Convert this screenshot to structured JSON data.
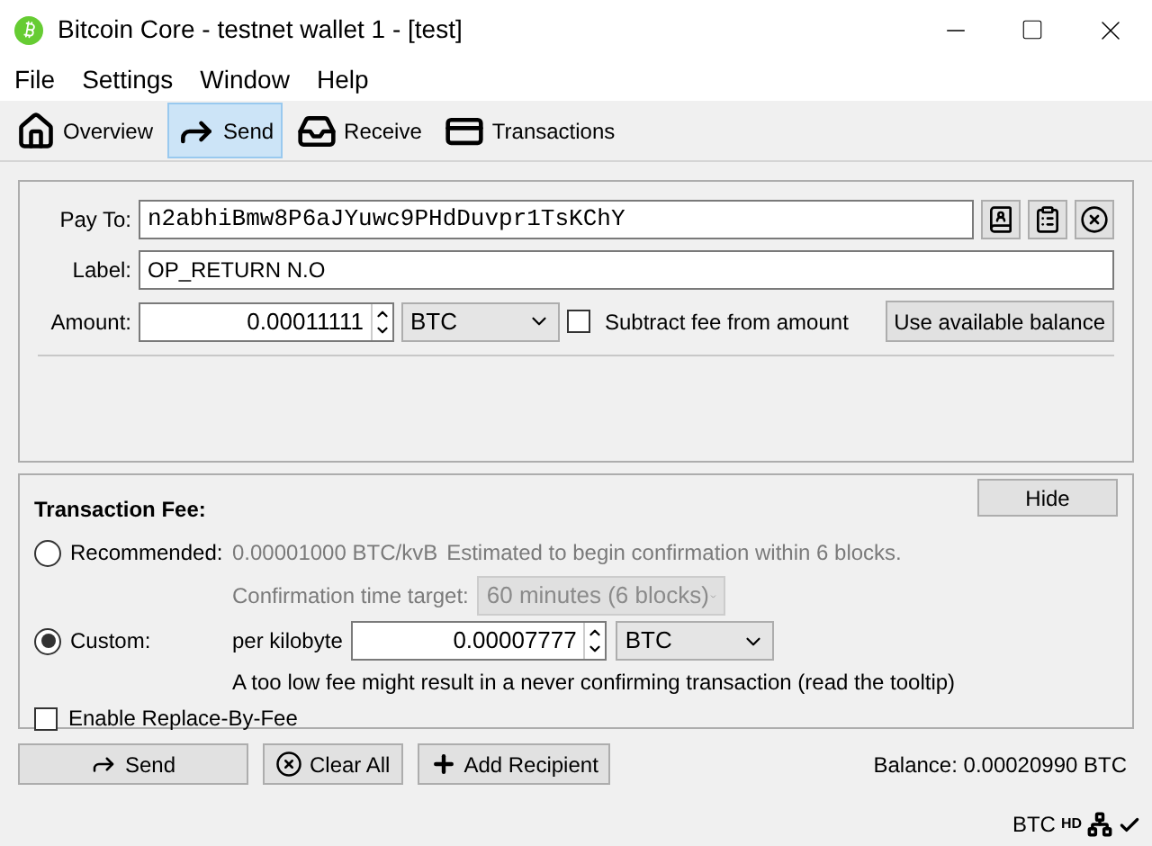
{
  "window": {
    "title": "Bitcoin Core - testnet wallet 1 - [test]"
  },
  "menu": [
    "File",
    "Settings",
    "Window",
    "Help"
  ],
  "toolbar": [
    {
      "label": "Overview",
      "kind": "home",
      "selected": false
    },
    {
      "label": "Send",
      "kind": "send",
      "selected": true
    },
    {
      "label": "Receive",
      "kind": "receive",
      "selected": false
    },
    {
      "label": "Transactions",
      "kind": "transactions",
      "selected": false
    }
  ],
  "recipient": {
    "pay_to_label": "Pay To:",
    "pay_to": "n2abhiBmw8P6aJYuwc9PHdDuvpr1TsKChY",
    "label_label": "Label:",
    "label": "OP_RETURN N.O",
    "amount_label": "Amount:",
    "amount": "0.00011111",
    "unit": "BTC",
    "subtract_fee": {
      "label": "Subtract fee from amount",
      "checked": false
    },
    "use_balance": "Use available balance"
  },
  "fee": {
    "title": "Transaction Fee:",
    "hide": "Hide",
    "recommended": {
      "label": "Recommended:",
      "selected": false,
      "rate": "0.00001000 BTC/kvB",
      "estimate": "Estimated to begin confirmation within 6 blocks.",
      "target_label": "Confirmation time target:",
      "target": "60 minutes (6 blocks)"
    },
    "custom": {
      "label": "Custom:",
      "selected": true,
      "per_label": "per kilobyte",
      "value": "0.00007777",
      "unit": "BTC",
      "warning": "A too low fee might result in a never confirming transaction (read the tooltip)"
    },
    "rbf": {
      "label": "Enable Replace-By-Fee",
      "checked": false
    }
  },
  "buttons": [
    {
      "label": "Send",
      "kind": "send"
    },
    {
      "label": "Clear All",
      "kind": "clear"
    },
    {
      "label": "Add Recipient",
      "kind": "add"
    }
  ],
  "balance": "Balance: 0.00020990 BTC",
  "status_bar": {
    "unit": "BTC",
    "hd": "HD"
  }
}
